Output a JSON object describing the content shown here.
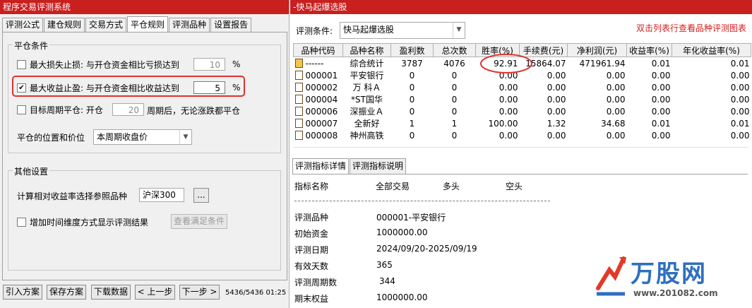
{
  "left": {
    "title": "程序交易评测系统",
    "tabs": [
      "评测公式",
      "建仓规则",
      "交易方式",
      "平仓规则",
      "评测品种",
      "设置报告"
    ],
    "close_group": {
      "title": "平仓条件",
      "stop_loss_label": "最大损失止损: 与开仓资金相比亏损达到",
      "stop_loss_value": "10",
      "stop_loss_unit": "%",
      "take_profit_label": "最大收益止盈: 与开仓资金相比收益达到",
      "take_profit_value": "5",
      "take_profit_unit": "%",
      "take_profit_checked": true,
      "period_label_a": "目标周期平仓: 开仓",
      "period_value": "20",
      "period_label_b": "周期后，无论涨跌都平仓",
      "position_label": "平仓的位置和价位",
      "position_value": "本周期收盘价"
    },
    "other_group": {
      "title": "其他设置",
      "ref_label": "计算相对收益率选择参照品种",
      "ref_value": "沪深300",
      "ref_button": "...",
      "time_label": "增加时间维度方式显示评测结果",
      "time_button": "查看满足条件"
    },
    "bottom_buttons": [
      "引入方案",
      "保存方案",
      "下载数据",
      "< 上一步",
      "下一步 >"
    ],
    "status": "5436/5436 01:25"
  },
  "right": {
    "title": "-快马起爆选股",
    "condition_label": "评测条件:",
    "condition_value": "快马起爆选股",
    "hint": "双击列表行查看品种评测图表",
    "columns": [
      "品种代码",
      "品种名称",
      "盈利数",
      "总次数",
      "胜率(%)",
      "手续费(元)",
      "净利润(元)",
      "收益率(%)",
      "年化收益率(%)"
    ],
    "rows": [
      [
        "------",
        "综合统计",
        "3787",
        "4076",
        "92.91",
        "15864.07",
        "471961.94",
        "0.01",
        "0.01"
      ],
      [
        "000001",
        "平安银行",
        "0",
        "0",
        "0.00",
        "0.00",
        "0.00",
        "0.00",
        "0.00"
      ],
      [
        "000002",
        "万 科Ａ",
        "0",
        "0",
        "0.00",
        "0.00",
        "0.00",
        "0.00",
        "0.00"
      ],
      [
        "000004",
        "*ST国华",
        "0",
        "0",
        "0.00",
        "0.00",
        "0.00",
        "0.00",
        "0.00"
      ],
      [
        "000006",
        "深振业Ａ",
        "0",
        "0",
        "0.00",
        "0.00",
        "0.00",
        "0.00",
        "0.00"
      ],
      [
        "000007",
        "全新好",
        "1",
        "1",
        "100.00",
        "1.32",
        "34.68",
        "0.01",
        "0.01"
      ],
      [
        "000008",
        "神州高铁",
        "0",
        "0",
        "0.00",
        "0.00",
        "0.00",
        "0.00",
        "0.00"
      ]
    ],
    "detail_tabs": [
      "评测指标详情",
      "评测指标说明"
    ],
    "detail_header": [
      "指标名称",
      "全部交易",
      "多头",
      "空头"
    ],
    "detail_rows": [
      [
        "评测品种",
        "000001-平安银行"
      ],
      [
        "初始资金",
        "1000000.00"
      ],
      [
        "评测日期",
        "2024/09/20-2025/09/19"
      ],
      [
        "有效天数",
        "365"
      ],
      [
        "评测周期数",
        "344"
      ],
      [
        "期末权益",
        "1000000.00"
      ]
    ],
    "logo_text": "万股网",
    "logo_url": "www.201082.com"
  },
  "colors": {
    "titlebar": "#c81f1f",
    "highlight": "#e0312e",
    "hint": "#d21e1e"
  }
}
